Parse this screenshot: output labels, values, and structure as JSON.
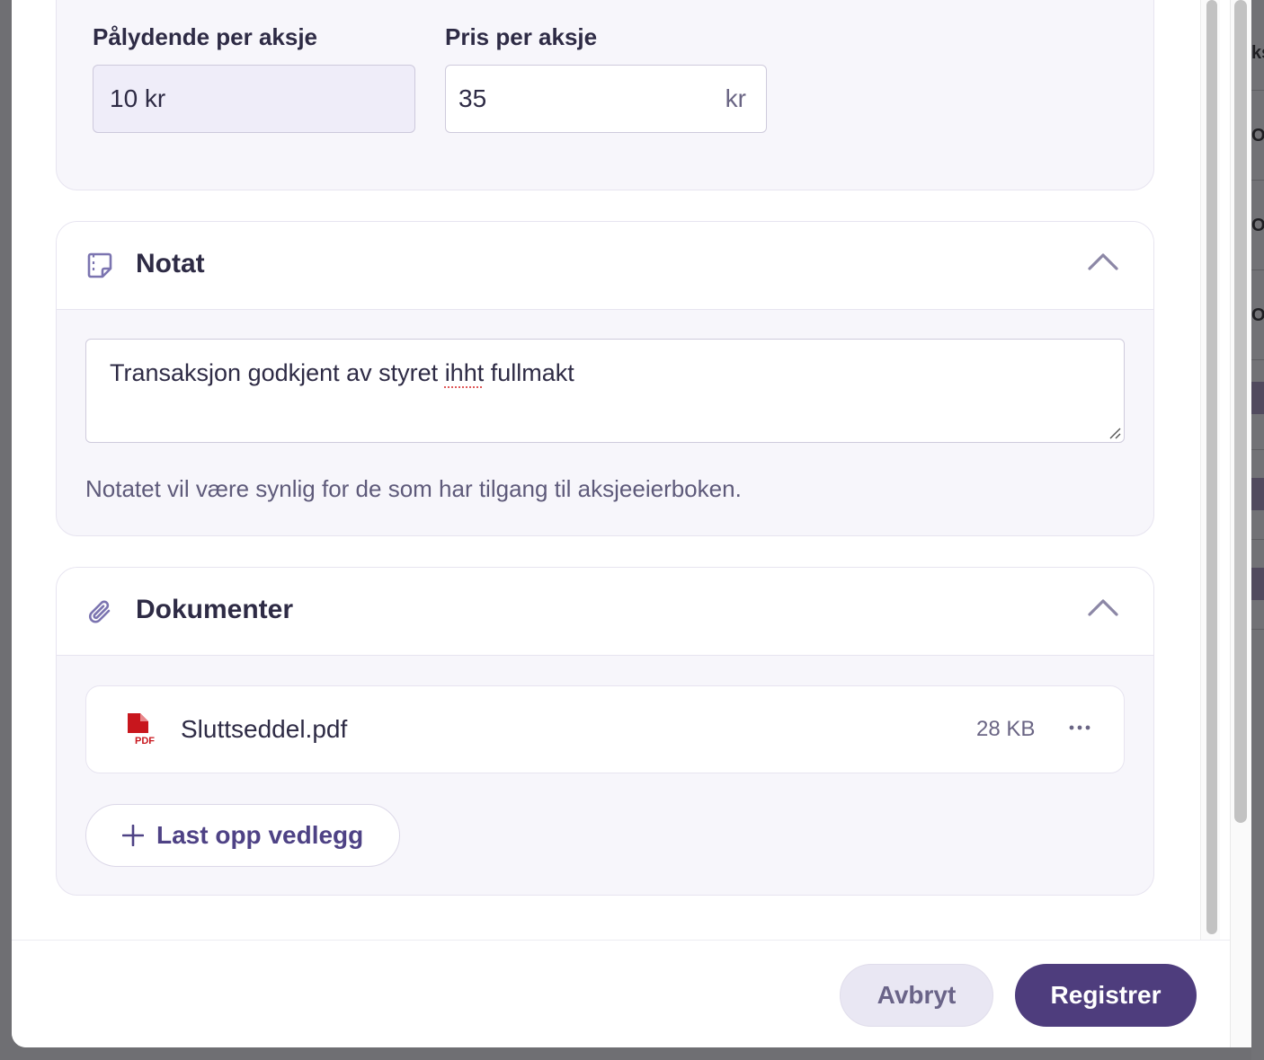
{
  "price_card": {
    "nominal_label": "Pålydende per aksje",
    "nominal_value": "10 kr",
    "price_label": "Pris per aksje",
    "price_value": "35",
    "price_unit": "kr"
  },
  "note_card": {
    "title": "Notat",
    "icon": "note-icon",
    "text_before": "Transaksjon godkjent av styret ",
    "text_flagged": "ihht",
    "text_after": " fullmakt",
    "helper": "Notatet vil være synlig for de som har tilgang til aksjeeierboken."
  },
  "docs_card": {
    "title": "Dokumenter",
    "icon": "paperclip-icon",
    "files": [
      {
        "name": "Sluttseddel.pdf",
        "size": "28 KB",
        "icon": "pdf-file-icon"
      }
    ],
    "upload_label": "Last opp vedlegg"
  },
  "footer": {
    "cancel_label": "Avbryt",
    "submit_label": "Registrer"
  },
  "colors": {
    "primary": "#4e3d7d",
    "card_bg": "#f7f6fb",
    "pdf_red": "#c8161d",
    "icon_accent": "#7b74b0"
  }
}
